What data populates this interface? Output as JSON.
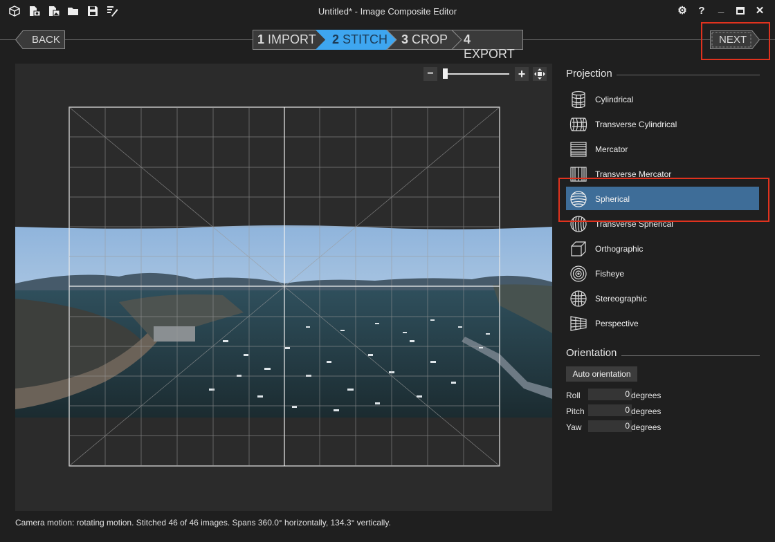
{
  "window": {
    "title": "Untitled* - Image Composite Editor"
  },
  "toolbar": {
    "icons": [
      "new-panorama-icon",
      "new-from-video-icon",
      "new-from-images-icon",
      "open-icon",
      "save-icon",
      "clean-icon"
    ]
  },
  "window_controls": {
    "settings": "⚙",
    "help": "?",
    "minimize": "_",
    "maximize": "□",
    "close": "✕"
  },
  "nav": {
    "back_label": "BACK",
    "next_label": "NEXT",
    "steps": [
      {
        "num": "1",
        "label": "IMPORT",
        "active": false
      },
      {
        "num": "2",
        "label": "STITCH",
        "active": true
      },
      {
        "num": "3",
        "label": "CROP",
        "active": false
      },
      {
        "num": "4",
        "label": "EXPORT",
        "active": false
      }
    ]
  },
  "zoom": {
    "minus": "−",
    "plus": "+",
    "level": 0.0
  },
  "status": {
    "text": "Camera motion: rotating motion. Stitched 46 of 46 images. Spans 360.0° horizontally, 134.3° vertically."
  },
  "projection": {
    "title": "Projection",
    "items": [
      {
        "label": "Cylindrical",
        "icon": "cylindrical-icon",
        "selected": false
      },
      {
        "label": "Transverse Cylindrical",
        "icon": "transverse-cylindrical-icon",
        "selected": false
      },
      {
        "label": "Mercator",
        "icon": "mercator-icon",
        "selected": false
      },
      {
        "label": "Transverse Mercator",
        "icon": "transverse-mercator-icon",
        "selected": false
      },
      {
        "label": "Spherical",
        "icon": "spherical-icon",
        "selected": true
      },
      {
        "label": "Transverse Spherical",
        "icon": "transverse-spherical-icon",
        "selected": false
      },
      {
        "label": "Orthographic",
        "icon": "orthographic-icon",
        "selected": false
      },
      {
        "label": "Fisheye",
        "icon": "fisheye-icon",
        "selected": false
      },
      {
        "label": "Stereographic",
        "icon": "stereographic-icon",
        "selected": false
      },
      {
        "label": "Perspective",
        "icon": "perspective-icon",
        "selected": false
      }
    ]
  },
  "orientation": {
    "title": "Orientation",
    "auto_label": "Auto orientation",
    "rows": [
      {
        "label": "Roll",
        "value": "0",
        "unit": "degrees"
      },
      {
        "label": "Pitch",
        "value": "0",
        "unit": "degrees"
      },
      {
        "label": "Yaw",
        "value": "0",
        "unit": "degrees"
      }
    ]
  },
  "colors": {
    "accent": "#3ea6f0",
    "selected": "#3e6d98",
    "highlight": "#e0321e"
  }
}
